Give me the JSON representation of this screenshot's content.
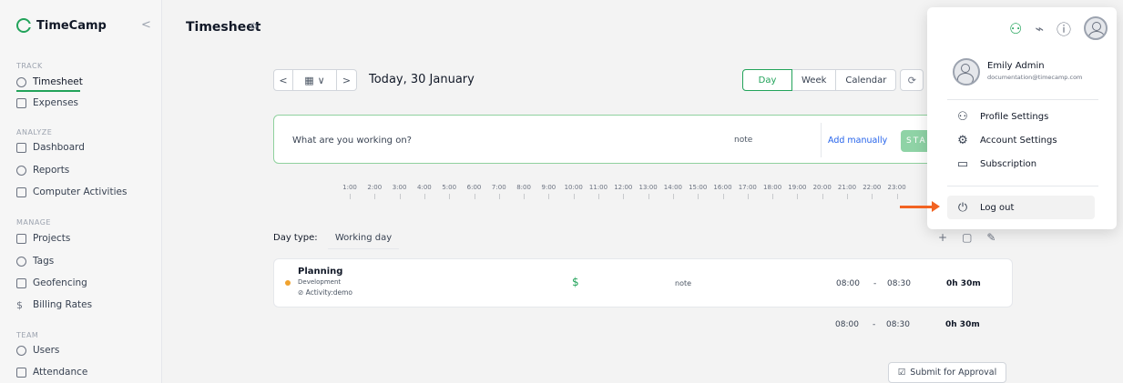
{
  "app": {
    "brand": "TimeCamp",
    "collapse_icon": "chevron-left-icon"
  },
  "sidebar": {
    "track": {
      "label": "TRACK",
      "items": [
        {
          "label": "Timesheet",
          "icon": "clock-icon",
          "active": true
        },
        {
          "label": "Expenses",
          "icon": "receipt-icon"
        }
      ]
    },
    "analyze": {
      "label": "ANALYZE",
      "items": [
        {
          "label": "Dashboard",
          "icon": "grid-icon"
        },
        {
          "label": "Reports",
          "icon": "pie-chart-icon"
        },
        {
          "label": "Computer Activities",
          "icon": "monitor-icon"
        }
      ]
    },
    "manage": {
      "label": "MANAGE",
      "items": [
        {
          "label": "Projects",
          "icon": "folder-icon"
        },
        {
          "label": "Tags",
          "icon": "tag-icon"
        },
        {
          "label": "Geofencing",
          "icon": "map-pin-icon"
        },
        {
          "label": "Billing Rates",
          "icon": "dollar-icon"
        }
      ]
    },
    "team": {
      "label": "TEAM",
      "items": [
        {
          "label": "Users",
          "icon": "users-icon"
        },
        {
          "label": "Attendance",
          "icon": "calendar-icon"
        }
      ]
    }
  },
  "header": {
    "title": "Timesheet",
    "settings_icon": "gear-icon"
  },
  "date_nav": {
    "prev": "<",
    "next": ">",
    "calendar_icon": "calendar-icon",
    "caret": "∨",
    "today_label": "Today, 30 January"
  },
  "views": {
    "day": "Day",
    "week": "Week",
    "calendar": "Calendar",
    "sync_icon": "sync-icon"
  },
  "tracker": {
    "placeholder": "What are you working on?",
    "note": "note",
    "add_manually": "Add manually",
    "start": "STA"
  },
  "timeline": {
    "hours": [
      "1:00",
      "2:00",
      "3:00",
      "4:00",
      "5:00",
      "6:00",
      "7:00",
      "8:00",
      "9:00",
      "10:00",
      "11:00",
      "12:00",
      "13:00",
      "14:00",
      "15:00",
      "16:00",
      "17:00",
      "18:00",
      "19:00",
      "20:00",
      "21:00",
      "22:00",
      "23:00"
    ]
  },
  "day_type": {
    "label": "Day type:",
    "value": "Working day"
  },
  "entry_actions": {
    "add": "+",
    "copy_icon": "copy-icon",
    "edit_icon": "edit-icon"
  },
  "entry": {
    "project": "Planning",
    "task": "Development",
    "tag": "Activity:demo",
    "billable": "$",
    "note": "note",
    "start": "08:00",
    "separator": "-",
    "end": "08:30",
    "duration": "0h 30m"
  },
  "total": {
    "start": "08:00",
    "separator": "-",
    "end": "08:30",
    "duration": "0h 30m"
  },
  "submit": {
    "label": "Submit for Approval"
  },
  "menu": {
    "user": {
      "name": "Emily Admin",
      "email": "documentation@timecamp.com"
    },
    "items": [
      {
        "label": "Profile Settings",
        "icon": "user-settings-icon"
      },
      {
        "label": "Account Settings",
        "icon": "gear-icon"
      },
      {
        "label": "Subscription",
        "icon": "credit-card-icon"
      }
    ],
    "logout": {
      "label": "Log out",
      "icon": "power-icon"
    }
  },
  "colors": {
    "brand_green": "#22a35a",
    "arrow_orange": "#f26322",
    "link_blue": "#2563eb"
  }
}
